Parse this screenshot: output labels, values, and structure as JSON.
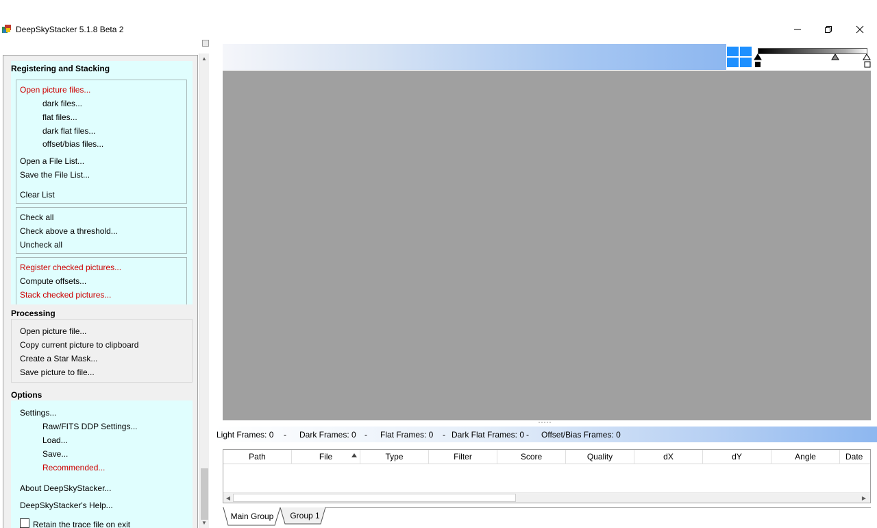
{
  "window": {
    "title": "DeepSkyStacker 5.1.8 Beta 2",
    "minimize_glyph": "—",
    "maximize_glyph": "❐",
    "close_glyph": "✕"
  },
  "left_panel": {
    "registering": {
      "header": "Registering and Stacking",
      "group1": [
        {
          "label": "Open picture files...",
          "red": true,
          "indent": 1
        },
        {
          "label": "dark files...",
          "red": false,
          "indent": 2
        },
        {
          "label": "flat files...",
          "red": false,
          "indent": 2
        },
        {
          "label": "dark flat files...",
          "red": false,
          "indent": 2
        },
        {
          "label": "offset/bias files...",
          "red": false,
          "indent": 2
        },
        {
          "label": "Open a File List...",
          "red": false,
          "indent": 1
        },
        {
          "label": "Save the File List...",
          "red": false,
          "indent": 1
        },
        {
          "label": "Clear List",
          "red": false,
          "indent": 1
        }
      ],
      "group2": [
        {
          "label": "Check all"
        },
        {
          "label": "Check above a threshold..."
        },
        {
          "label": "Uncheck all"
        }
      ],
      "group3": [
        {
          "label": "Register checked pictures...",
          "red": true
        },
        {
          "label": "Compute offsets...",
          "red": false
        },
        {
          "label": "Stack checked pictures...",
          "red": true
        }
      ]
    },
    "processing": {
      "header": "Processing",
      "items": [
        {
          "label": "Open picture file..."
        },
        {
          "label": "Copy current picture to clipboard"
        },
        {
          "label": "Create a Star Mask..."
        },
        {
          "label": "Save picture to file..."
        }
      ]
    },
    "options": {
      "header": "Options",
      "items": [
        {
          "label": "Settings...",
          "red": false,
          "indent": 1
        },
        {
          "label": "Raw/FITS DDP Settings...",
          "red": false,
          "indent": 2
        },
        {
          "label": "Load...",
          "red": false,
          "indent": 2
        },
        {
          "label": "Save...",
          "red": false,
          "indent": 2
        },
        {
          "label": "Recommended...",
          "red": true,
          "indent": 2
        },
        {
          "label": "About DeepSkyStacker...",
          "red": false,
          "indent": 1
        },
        {
          "label": "DeepSkyStacker's Help...",
          "red": false,
          "indent": 1
        }
      ],
      "retain_trace": {
        "label": "Retain the trace file on exit",
        "checked": false
      }
    }
  },
  "stats": {
    "light": "Light Frames: 0",
    "sep1": "-",
    "dark": "Dark Frames: 0",
    "sep2": "-",
    "flat": "Flat Frames: 0",
    "sep3": "-",
    "darkflat": "Dark Flat Frames: 0",
    "sep4": "-",
    "offset": "Offset/Bias Frames: 0"
  },
  "table": {
    "columns": [
      "Path",
      "File",
      "Type",
      "Filter",
      "Score",
      "Quality",
      "dX",
      "dY",
      "Angle",
      "Date"
    ],
    "sort_column": "File",
    "rows": []
  },
  "tabs": [
    {
      "label": "Main Group",
      "active": true
    },
    {
      "label": "Group 1",
      "active": false
    }
  ],
  "colors": {
    "panel_bg": "#e0fefe",
    "red_item": "#cc0000",
    "image_bg": "#a0a0a0"
  }
}
